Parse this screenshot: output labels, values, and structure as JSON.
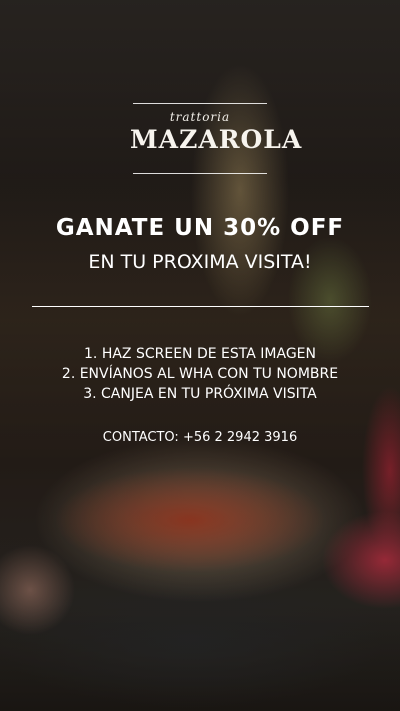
{
  "brand": {
    "small": "trattoria",
    "name": "MAZAROLA"
  },
  "promo": {
    "headline": "GANATE UN 30% OFF",
    "subheadline": "EN TU PROXIMA VISITA!"
  },
  "steps": [
    "1. HAZ SCREEN DE ESTA IMAGEN",
    "2. ENVÍANOS AL WHA CON TU NOMBRE",
    "3. CANJEA EN TU PRÓXIMA VISITA"
  ],
  "contact": "CONTACTO: +56 2 2942 3916"
}
